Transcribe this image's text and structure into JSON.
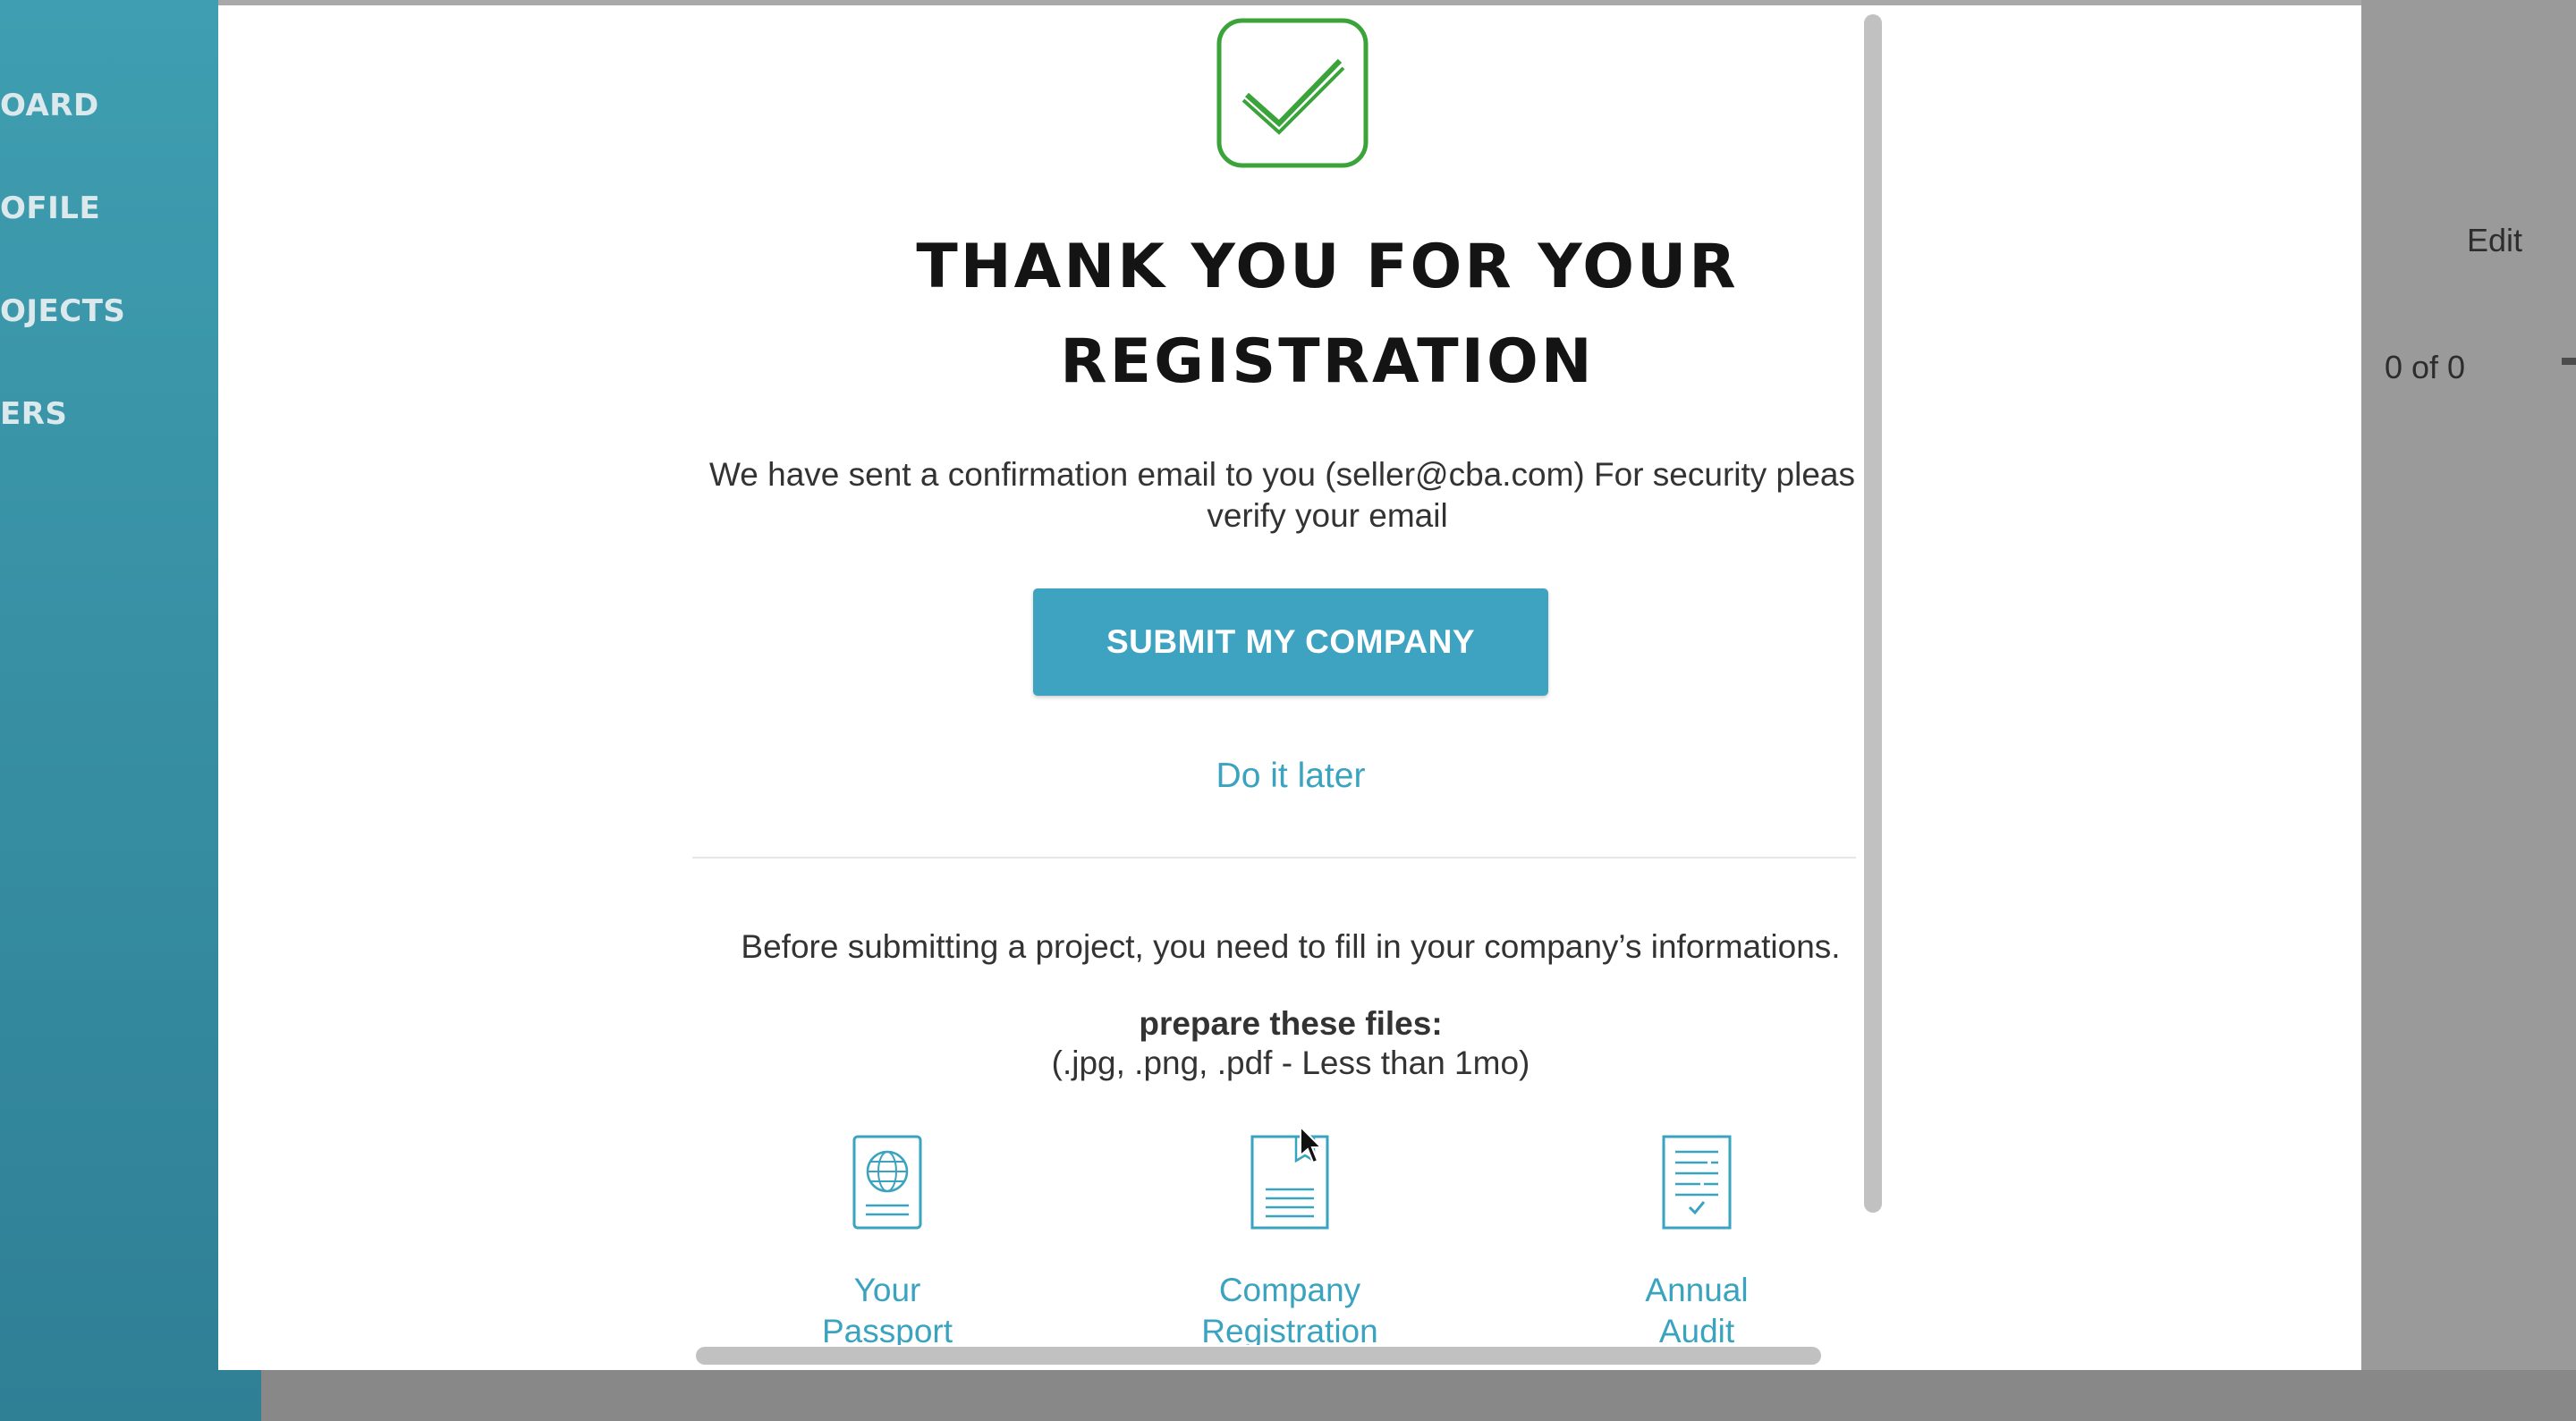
{
  "sidebar": {
    "items": [
      {
        "label": "OARD"
      },
      {
        "label": "OFILE"
      },
      {
        "label": "OJECTS"
      },
      {
        "label": "ERS"
      }
    ]
  },
  "background_page": {
    "edit_label": "Edit",
    "pagination": "0 of 0"
  },
  "modal": {
    "icon": "checkmark-icon",
    "title_line1": "THANK YOU FOR YOUR",
    "title_line2": "REGISTRATION",
    "confirmation_line1": "We have sent a confirmation email to you (seller@cba.com) For security please",
    "confirmation_line2": "verify your email",
    "submit_label": "SUBMIT MY COMPANY",
    "later_label": "Do it later",
    "before_text": "Before submitting a project, you need to fill in your company’s informations.",
    "prepare_title": "prepare these files:",
    "prepare_sub": "(.jpg, .png, .pdf - Less than 1mo)",
    "files": [
      {
        "icon": "passport-icon",
        "line1": "Your",
        "line2": "Passport"
      },
      {
        "icon": "registration-document-icon",
        "line1": "Company",
        "line2": "Registration"
      },
      {
        "icon": "audit-document-icon",
        "line1": "Annual",
        "line2": "Audit"
      }
    ]
  },
  "colors": {
    "accent": "#3ea3c1",
    "success": "#3aa33a",
    "sidebar": "#3a93a8"
  }
}
